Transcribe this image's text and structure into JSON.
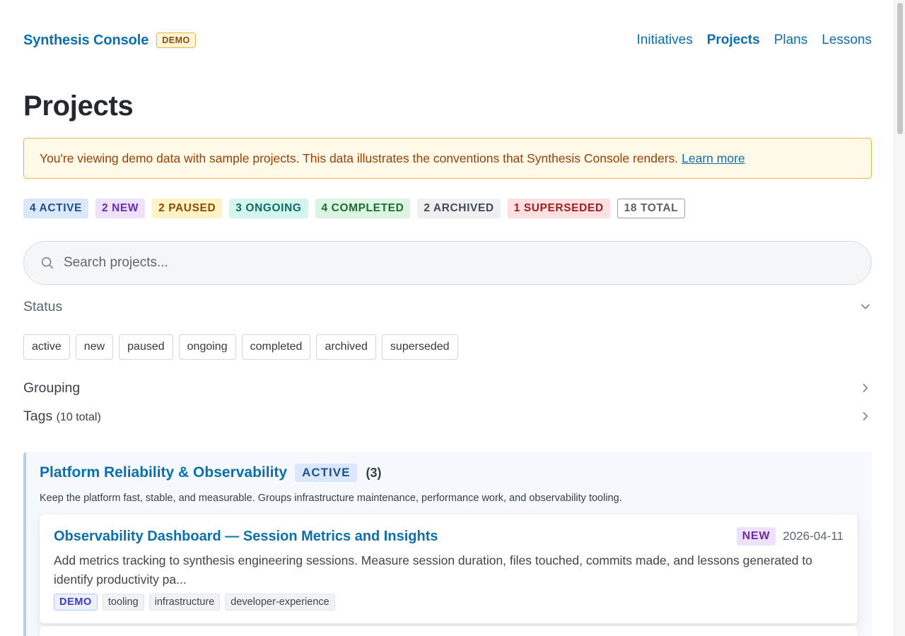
{
  "header": {
    "brand": "Synthesis Console",
    "badge": "DEMO",
    "nav": [
      {
        "label": "Initiatives"
      },
      {
        "label": "Projects",
        "current": true
      },
      {
        "label": "Plans"
      },
      {
        "label": "Lessons"
      }
    ]
  },
  "page_title": "Projects",
  "notice": {
    "text": "You're viewing demo data with sample projects. This data illustrates the conventions that Synthesis Console renders.",
    "link": "Learn more"
  },
  "counts": [
    {
      "label": "4 ACTIVE",
      "color": "#1e4f8c",
      "bg": "#dbe8fb"
    },
    {
      "label": "2 NEW",
      "color": "#6b2bb0",
      "bg": "#eee2fb"
    },
    {
      "label": "2 PAUSED",
      "color": "#8a4c06",
      "bg": "#fdf3c4"
    },
    {
      "label": "3 ONGOING",
      "color": "#0d6b63",
      "bg": "#d4f5ee"
    },
    {
      "label": "4 COMPLETED",
      "color": "#1d6d33",
      "bg": "#dcf4e2"
    },
    {
      "label": "2 ARCHIVED",
      "color": "#444b53",
      "bg": "#eef0f2"
    },
    {
      "label": "1 SUPERSEDED",
      "color": "#a11d23",
      "bg": "#fde0e0"
    },
    {
      "label": "18 TOTAL",
      "color": "#5c636b",
      "bg": "#ffffff",
      "outlined": true
    }
  ],
  "search": {
    "placeholder": "Search projects..."
  },
  "filters": {
    "status_label": "Status",
    "status_options": [
      "active",
      "new",
      "paused",
      "ongoing",
      "completed",
      "archived",
      "superseded"
    ],
    "grouping_label": "Grouping",
    "tags_label": "Tags",
    "tags_sub": "(10 total)"
  },
  "group": {
    "title": "Platform Reliability & Observability",
    "status": "ACTIVE",
    "count": "(3)",
    "description": "Keep the platform fast, stable, and measurable. Groups infrastructure maintenance, performance work, and observability tooling."
  },
  "project": {
    "title": "Observability Dashboard — Session Metrics and Insights",
    "status": "NEW",
    "date": "2026-04-11",
    "description": "Add metrics tracking to synthesis engineering sessions. Measure session duration, files touched, commits made, and lessons generated to identify productivity pa...",
    "tags": [
      "DEMO",
      "tooling",
      "infrastructure",
      "developer-experience"
    ]
  }
}
